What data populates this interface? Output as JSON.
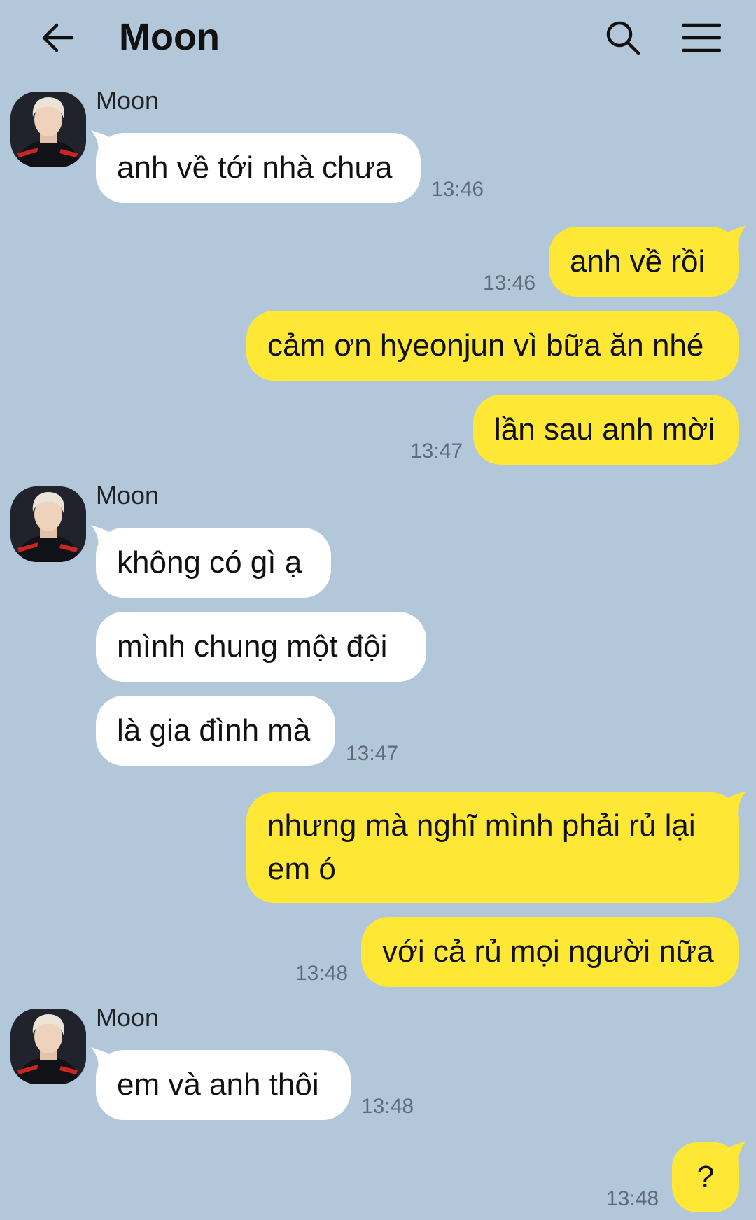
{
  "header": {
    "title": "Moon",
    "back_icon": "arrow-left-icon",
    "search_icon": "search-icon",
    "menu_icon": "hamburger-menu-icon"
  },
  "colors": {
    "background": "#b2c7da",
    "incoming_bubble": "#ffffff",
    "outgoing_bubble": "#fee835",
    "timestamp": "#5f6b78"
  },
  "messages": [
    {
      "sender": "Moon",
      "direction": "in",
      "text": "anh về tới nhà chưa",
      "time": "13:46"
    },
    {
      "direction": "out",
      "text": "anh về rồi",
      "time": "13:46"
    },
    {
      "direction": "out",
      "text": "cảm ơn hyeonjun vì bữa ăn nhé"
    },
    {
      "direction": "out",
      "text": "lần sau anh mời",
      "time": "13:47"
    },
    {
      "sender": "Moon",
      "direction": "in",
      "text": "không có gì ạ"
    },
    {
      "direction": "in",
      "text": "mình chung một đội"
    },
    {
      "direction": "in",
      "text": "là gia đình mà",
      "time": "13:47"
    },
    {
      "direction": "out",
      "text": "nhưng mà nghĩ mình phải rủ lại em ó"
    },
    {
      "direction": "out",
      "text": "với cả rủ mọi người nữa",
      "time": "13:48"
    },
    {
      "sender": "Moon",
      "direction": "in",
      "text": "em và anh thôi",
      "time": "13:48"
    },
    {
      "direction": "out",
      "text": "?",
      "time": "13:48"
    }
  ]
}
